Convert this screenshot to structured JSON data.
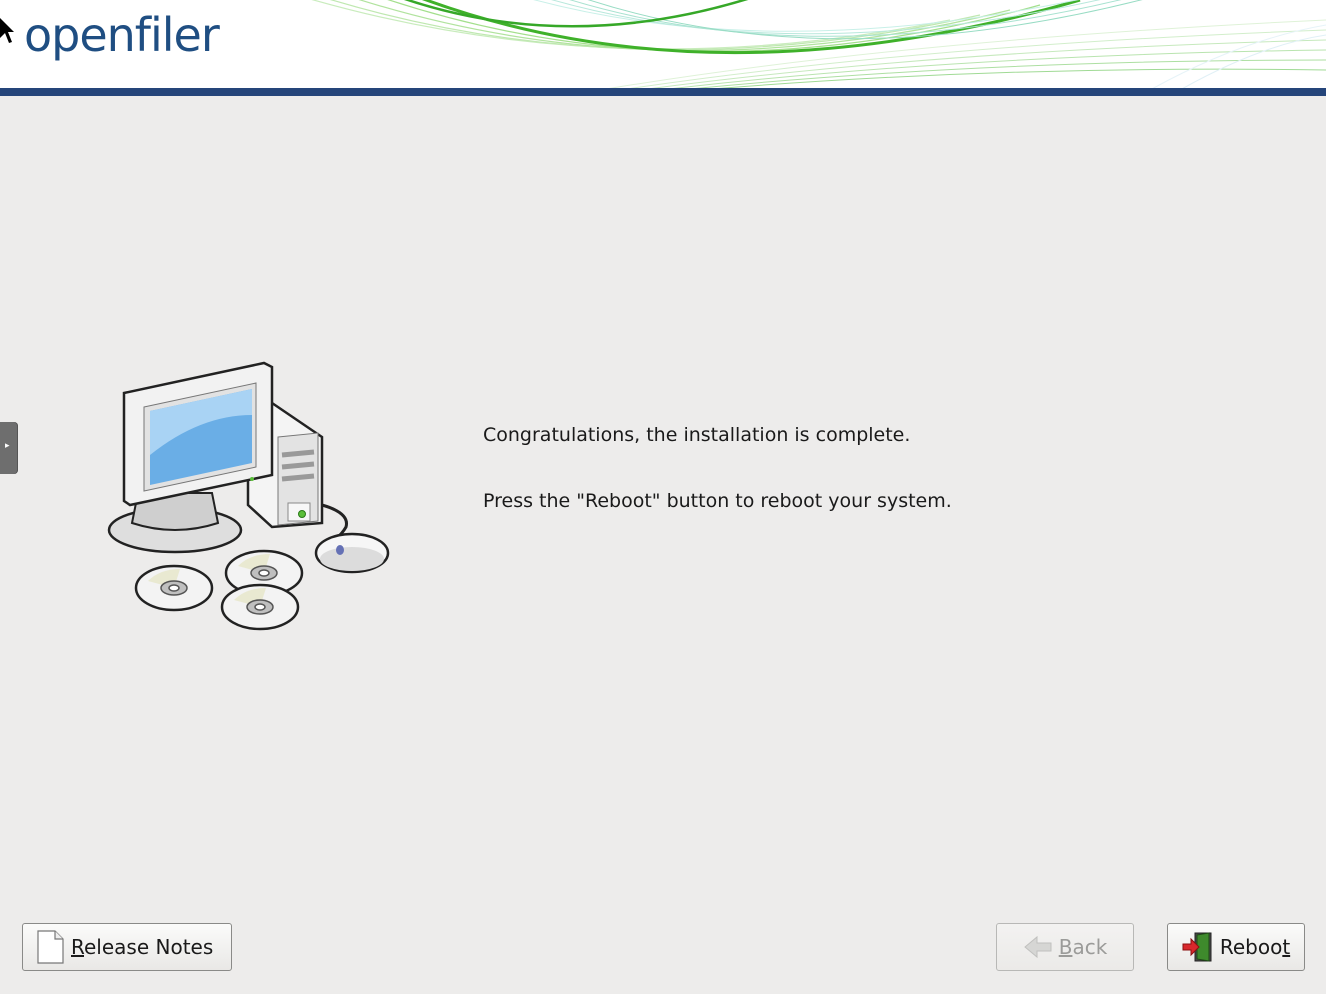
{
  "header": {
    "logo_text": "openfiler",
    "brand_color": "#1f4e82",
    "bar_color": "#25457a",
    "accent_green": "#4fbf2f"
  },
  "main": {
    "illustration_icon": "computer-with-discs-icon",
    "message_line1": "Congratulations, the installation is complete.",
    "message_line2": "Press the \"Reboot\" button to reboot your system."
  },
  "side_tab": {
    "icon": "expand-arrow-icon"
  },
  "buttons": {
    "release_notes": {
      "icon": "document-icon",
      "mnemonic": "R",
      "label_rest": "elease Notes"
    },
    "back": {
      "icon": "back-arrow-icon",
      "mnemonic": "B",
      "label_rest": "ack",
      "disabled": true
    },
    "reboot": {
      "icon": "exit-door-icon",
      "label_start": "Reboo",
      "mnemonic": "t"
    }
  }
}
